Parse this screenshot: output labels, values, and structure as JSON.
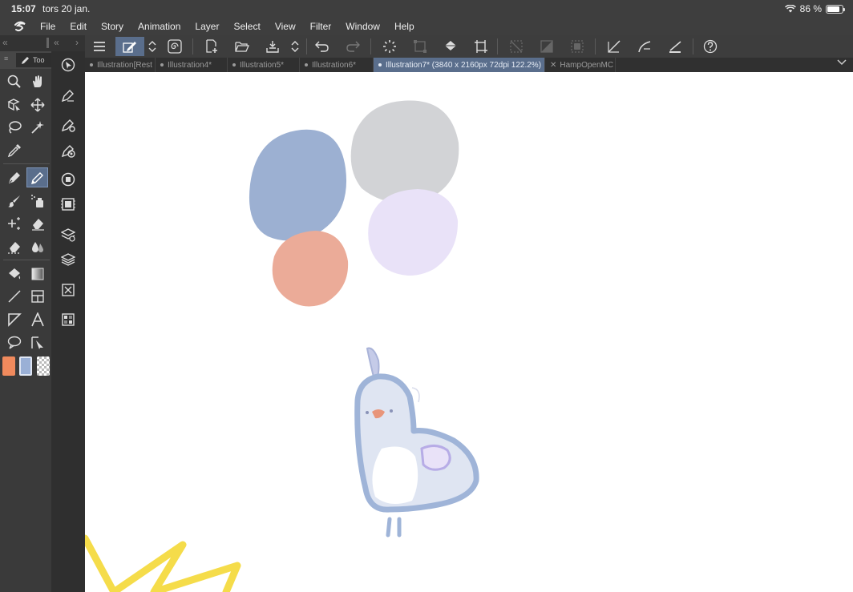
{
  "status_bar": {
    "time": "15:07",
    "date": "tors 20 jan.",
    "battery": "86 %",
    "battery_level": 0.86
  },
  "menu": {
    "items": [
      "File",
      "Edit",
      "Story",
      "Animation",
      "Layer",
      "Select",
      "View",
      "Filter",
      "Window",
      "Help"
    ]
  },
  "tool_palette": {
    "tab_label": "Too"
  },
  "tools": [
    "zoom-tool-icon",
    "hand-tool-icon",
    "object-tool-icon",
    "move-layer-icon",
    "lasso-selection-icon",
    "magic-wand-icon",
    "eyedropper-icon",
    "pen-tool-icon",
    "pencil-tool-icon",
    "brush-tool-icon",
    "airbrush-tool-icon",
    "decoration-tool-icon",
    "eraser-tool-icon",
    "eraser-alt-icon",
    "blend-tool-icon",
    "fill-tool-icon",
    "gradient-tool-icon",
    "figure-tool-icon",
    "frame-border-icon",
    "ruler-tool-icon",
    "text-tool-icon",
    "balloon-tool-icon",
    "correct-line-icon"
  ],
  "colors": {
    "main": "#f08a5d",
    "sub": "#9ab0d6",
    "accent": "#5a6e8c",
    "swatch_blue": "#9cb0d2",
    "swatch_grey": "#d2d3d6",
    "swatch_lavender": "#e9e2f8",
    "swatch_peach": "#ebab98",
    "yellow_stroke": "#f5dc4a"
  },
  "tabs": [
    {
      "label": "Illustration[Rest",
      "active": false,
      "closable": false
    },
    {
      "label": "Illustration4*",
      "active": false,
      "closable": false
    },
    {
      "label": "Illustration5*",
      "active": false,
      "closable": false
    },
    {
      "label": "Illustration6*",
      "active": false,
      "closable": false
    },
    {
      "label": "Illustration7* (3840 x 2160px 72dpi 122.2%)",
      "active": true,
      "closable": false
    },
    {
      "label": "HampOpenMC",
      "active": false,
      "closable": true
    }
  ]
}
